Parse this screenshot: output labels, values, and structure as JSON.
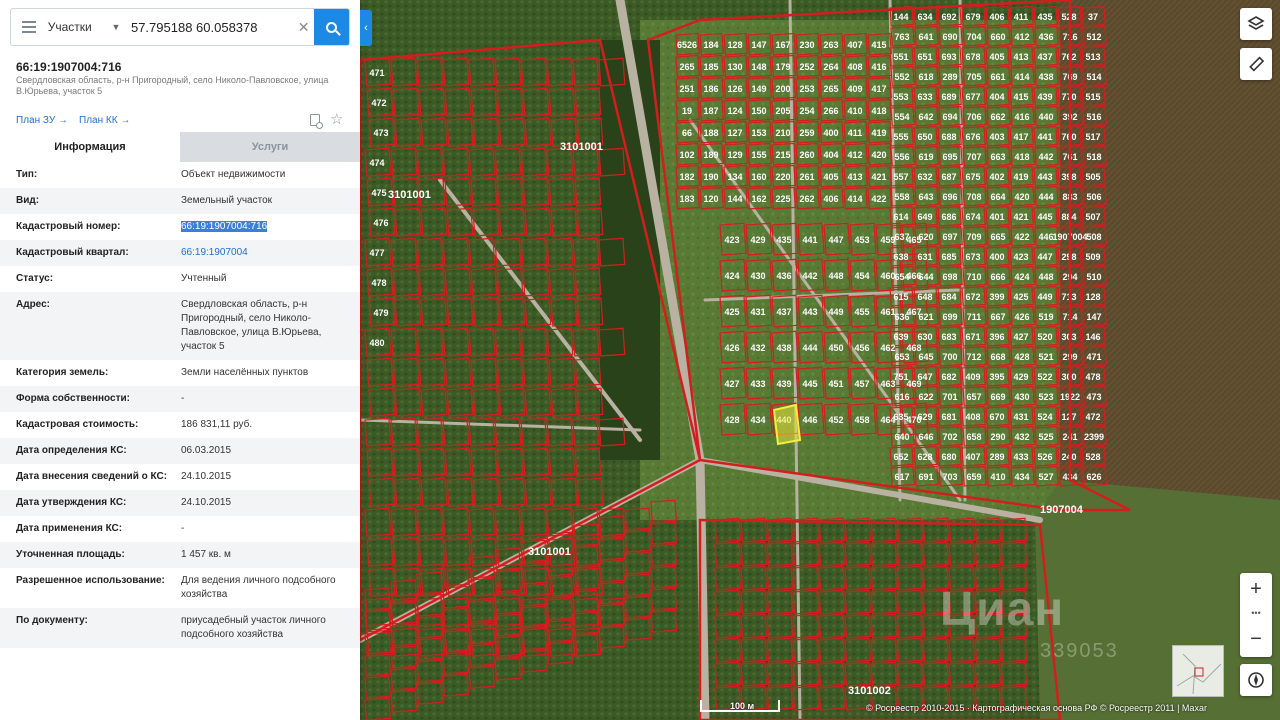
{
  "search": {
    "type_label": "Участки",
    "query": "57.795188 60.058378",
    "clear_glyph": "✕",
    "menu_icon": "menu-icon",
    "search_icon": "search-icon"
  },
  "object": {
    "cadastral_number": "66:19:1907004:716",
    "address_short": "Свердловская область, р-н Пригородный, село Николо-Павловское, улица В.Юрьева, участок 5",
    "plan_zu": "План ЗУ →",
    "plan_kk": "План КК →"
  },
  "tabs": {
    "info": "Информация",
    "services": "Услуги"
  },
  "fields": [
    {
      "key": "Тип:",
      "value": "Объект недвижимости"
    },
    {
      "key": "Вид:",
      "value": "Земельный участок"
    },
    {
      "key": "Кадастровый номер:",
      "value": "66:19:1907004:716"
    },
    {
      "key": "Кадастровый квартал:",
      "value": "66:19:1907004"
    },
    {
      "key": "Статус:",
      "value": "Учтенный"
    },
    {
      "key": "Адрес:",
      "value": "Свердловская область, р-н Пригородный, село Николо-Павловское, улица В.Юрьева, участок 5"
    },
    {
      "key": "Категория земель:",
      "value": "Земли населённых пунктов"
    },
    {
      "key": "Форма собственности:",
      "value": "-"
    },
    {
      "key": "Кадастровая стоимость:",
      "value": "186 831,11 руб."
    },
    {
      "key": "Дата определения КС:",
      "value": "06.03.2015"
    },
    {
      "key": "Дата внесения сведений о КС:",
      "value": "24.10.2015"
    },
    {
      "key": "Дата утверждения КС:",
      "value": "24.10.2015"
    },
    {
      "key": "Дата применения КС:",
      "value": "-"
    },
    {
      "key": "Уточненная площадь:",
      "value": "1 457 кв. м"
    },
    {
      "key": "Разрешенное использование:",
      "value": "Для ведения личного подсобного хозяйства"
    },
    {
      "key": "По документу:",
      "value": "приусадебный участок личного подсобного хозяйства"
    }
  ],
  "map": {
    "quarter_labels": [
      "3101001",
      "3101001",
      "1907004",
      "3101001",
      "3101002"
    ],
    "parcel_labels": [
      "144",
      "763",
      "551",
      "552",
      "553",
      "554",
      "555",
      "556",
      "557",
      "558",
      "614",
      "637",
      "638",
      "654",
      "615",
      "636",
      "639",
      "653",
      "751",
      "616",
      "635",
      "640",
      "652",
      "617",
      "634",
      "641",
      "651",
      "618",
      "633",
      "642",
      "650",
      "619",
      "632",
      "643",
      "649",
      "620",
      "631",
      "644",
      "648",
      "621",
      "630",
      "645",
      "647",
      "622",
      "629",
      "646",
      "628",
      "691",
      "692",
      "690",
      "693",
      "289",
      "689",
      "694",
      "688",
      "695",
      "687",
      "696",
      "686",
      "697",
      "685",
      "698",
      "684",
      "699",
      "683",
      "700",
      "682",
      "701",
      "681",
      "702",
      "680",
      "703",
      "679",
      "704",
      "678",
      "705",
      "677",
      "706",
      "676",
      "707",
      "675",
      "708",
      "674",
      "709",
      "673",
      "710",
      "672",
      "711",
      "671",
      "712",
      "409",
      "657",
      "408",
      "658",
      "407",
      "659",
      "406",
      "660",
      "405",
      "661",
      "404",
      "662",
      "403",
      "663",
      "402",
      "664",
      "401",
      "665",
      "400",
      "666",
      "399",
      "667",
      "396",
      "668",
      "395",
      "669",
      "670",
      "290",
      "289",
      "410",
      "411",
      "412",
      "413",
      "414",
      "415",
      "416",
      "417",
      "418",
      "419",
      "420",
      "421",
      "422",
      "423",
      "424",
      "425",
      "426",
      "427",
      "428",
      "429",
      "430",
      "431",
      "432",
      "433",
      "434",
      "435",
      "436",
      "437",
      "438",
      "439",
      "440",
      "441",
      "442",
      "443",
      "444",
      "445",
      "446",
      "447",
      "448",
      "449",
      "519",
      "520",
      "521",
      "522",
      "523",
      "524",
      "525",
      "526",
      "527",
      "528",
      "716",
      "762",
      "769",
      "770",
      "392",
      "760",
      "761",
      "398",
      "883",
      "884",
      "1907004",
      "298",
      "294",
      "713",
      "714",
      "303",
      "299",
      "300",
      "1922",
      "127",
      "241",
      "240",
      "434",
      "37",
      "512",
      "513",
      "514",
      "515",
      "516",
      "517",
      "518",
      "505",
      "506",
      "507",
      "508",
      "509",
      "510",
      "128",
      "147",
      "146",
      "471",
      "478",
      "473",
      "472",
      "2399",
      "528",
      "626",
      "6526",
      "265",
      "251",
      "19",
      "66",
      "102",
      "182",
      "183",
      "184",
      "185",
      "186",
      "187",
      "188",
      "189",
      "190",
      "120",
      "128",
      "130",
      "126",
      "124",
      "127",
      "129",
      "134",
      "144",
      "147",
      "148",
      "149",
      "150",
      "153",
      "155",
      "160",
      "162",
      "167",
      "179",
      "200",
      "205",
      "210",
      "215",
      "220",
      "225",
      "230",
      "252",
      "253",
      "254",
      "259",
      "260",
      "261",
      "262",
      "263",
      "264",
      "265",
      "266",
      "400",
      "404",
      "405",
      "406",
      "407",
      "408",
      "409",
      "410",
      "411",
      "412",
      "413",
      "414",
      "415",
      "416",
      "417",
      "418",
      "419",
      "420",
      "421",
      "422",
      "423",
      "424",
      "425",
      "426",
      "427",
      "428",
      "429",
      "430",
      "431",
      "432",
      "433",
      "434",
      "435",
      "436",
      "437",
      "438",
      "439",
      "440",
      "441",
      "442",
      "443",
      "444",
      "445",
      "446",
      "447",
      "448",
      "449",
      "450",
      "451",
      "452",
      "453",
      "454",
      "455",
      "456",
      "457",
      "458",
      "459",
      "460",
      "461",
      "462",
      "463",
      "464",
      "465",
      "466",
      "467",
      "468",
      "469",
      "470",
      "471",
      "472",
      "473",
      "474",
      "475",
      "476",
      "477",
      "478",
      "479",
      "480"
    ],
    "scale_label": "100 м",
    "attribution": "© Росреестр 2010-2015 · Картографическая основа РФ © Росреестр 2011 | Maxar",
    "watermark": "Циан",
    "watermark_sub": "339053"
  },
  "controls": {
    "layers_icon": "layers-icon",
    "ruler_icon": "ruler-icon",
    "zoom_in": "+",
    "zoom_more": "•••",
    "zoom_out": "−",
    "compass_icon": "compass-icon"
  }
}
